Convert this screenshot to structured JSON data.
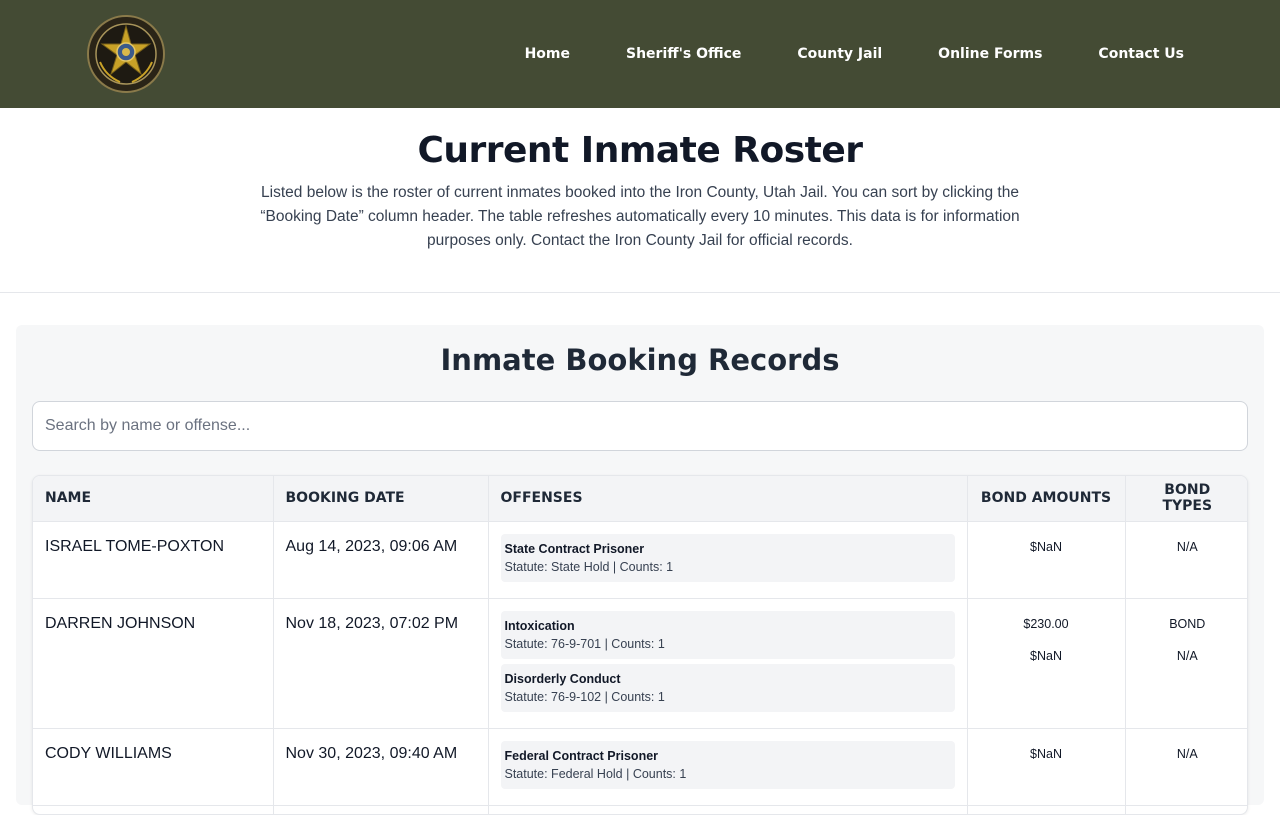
{
  "nav": {
    "items": [
      "Home",
      "Sheriff's Office",
      "County Jail",
      "Online Forms",
      "Contact Us"
    ]
  },
  "intro": {
    "title": "Current Inmate Roster",
    "description": "Listed below is the roster of current inmates booked into the Iron County, Utah Jail. You can sort by clicking the “Booking Date” column header. The table refreshes automatically every 10 minutes. This data is for information purposes only. Contact the Iron County Jail for official records."
  },
  "records": {
    "title": "Inmate Booking Records",
    "search_placeholder": "Search by name or offense...",
    "columns": [
      "NAME",
      "BOOKING DATE",
      "OFFENSES",
      "BOND AMOUNTS",
      "BOND TYPES"
    ],
    "rows": [
      {
        "name": "ISRAEL TOME-POXTON",
        "date": "Aug 14, 2023, 09:06 AM",
        "offenses": [
          {
            "name": "State Contract Prisoner",
            "meta": "Statute: State Hold | Counts: 1"
          }
        ],
        "bond_amounts": [
          "$NaN"
        ],
        "bond_types": [
          "N/A"
        ]
      },
      {
        "name": "DARREN JOHNSON",
        "date": "Nov 18, 2023, 07:02 PM",
        "offenses": [
          {
            "name": "Intoxication",
            "meta": "Statute: 76-9-701 | Counts: 1"
          },
          {
            "name": "Disorderly Conduct",
            "meta": "Statute: 76-9-102 | Counts: 1"
          }
        ],
        "bond_amounts": [
          "$230.00",
          "$NaN"
        ],
        "bond_types": [
          "BOND",
          "N/A"
        ]
      },
      {
        "name": "CODY WILLIAMS",
        "date": "Nov 30, 2023, 09:40 AM",
        "offenses": [
          {
            "name": "Federal Contract Prisoner",
            "meta": "Statute: Federal Hold | Counts: 1"
          }
        ],
        "bond_amounts": [
          "$NaN"
        ],
        "bond_types": [
          "N/A"
        ]
      }
    ]
  },
  "colors": {
    "header_bg": "#444b34",
    "badge_gold": "#c9a227",
    "panel_bg": "#f6f7f8"
  },
  "icons": {
    "logo": "sheriff-star-badge-icon"
  }
}
